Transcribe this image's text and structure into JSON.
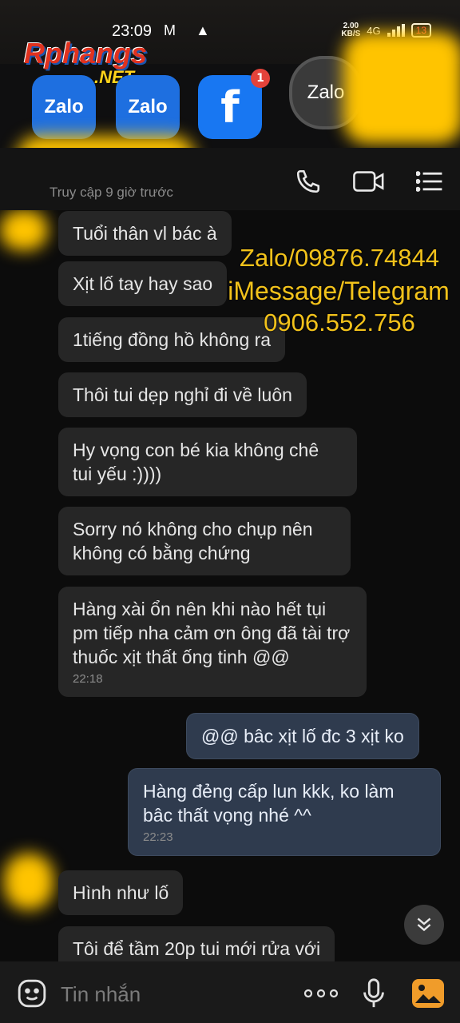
{
  "status": {
    "time": "23:09",
    "left_icons": "M ▲",
    "net_speed_value": "2.00",
    "net_speed_unit": "KB/S",
    "network": "4G",
    "battery": "13"
  },
  "brand": {
    "name": "Rphangs",
    "suffix": ".NET"
  },
  "apps": [
    {
      "label": "Zalo"
    },
    {
      "label": "Zalo"
    },
    {
      "label": "f",
      "badge": "1"
    },
    {
      "label": "Zalo"
    }
  ],
  "header": {
    "last_seen": "Truy cập 9 giờ trước"
  },
  "overlay": {
    "line1": "Zalo/09876.74844",
    "line2": "iMessage/Telegram",
    "line3": "0906.552.756"
  },
  "messages": [
    {
      "dir": "in",
      "text": "Tuổi thân vl bác à"
    },
    {
      "dir": "in",
      "text": "Xịt lố tay hay sao"
    },
    {
      "dir": "in",
      "text": "1tiếng đồng hồ không ra"
    },
    {
      "dir": "in",
      "text": "Thôi tui dẹp nghỉ đi về luôn"
    },
    {
      "dir": "in",
      "text": "Hy vọng con bé kia không chê tui yếu :))))"
    },
    {
      "dir": "in",
      "text": "Sorry nó không cho chụp nên không có bằng chứng"
    },
    {
      "dir": "in",
      "text": "Hàng xài ổn nên khi nào hết tụi pm tiếp nha cảm ơn ông đã tài trợ thuốc xịt thất ống tinh @@",
      "time": "22:18"
    },
    {
      "dir": "out",
      "text": "@@ bâc xịt lố đc 3 xịt ko"
    },
    {
      "dir": "out",
      "text": "Hàng đẻng cấp  lun kkk, ko làm bâc thất vọng nhé ^^",
      "time": "22:23"
    },
    {
      "dir": "in",
      "text": "Hình như lố"
    },
    {
      "dir": "in",
      "text": "Tôi để tầm 20p tui mới rửa với"
    }
  ],
  "composer": {
    "placeholder": "Tin nhắn"
  },
  "colors": {
    "bubble_in": "#262626",
    "bubble_out": "#2f3b4e",
    "accent": "#f2c21b"
  }
}
